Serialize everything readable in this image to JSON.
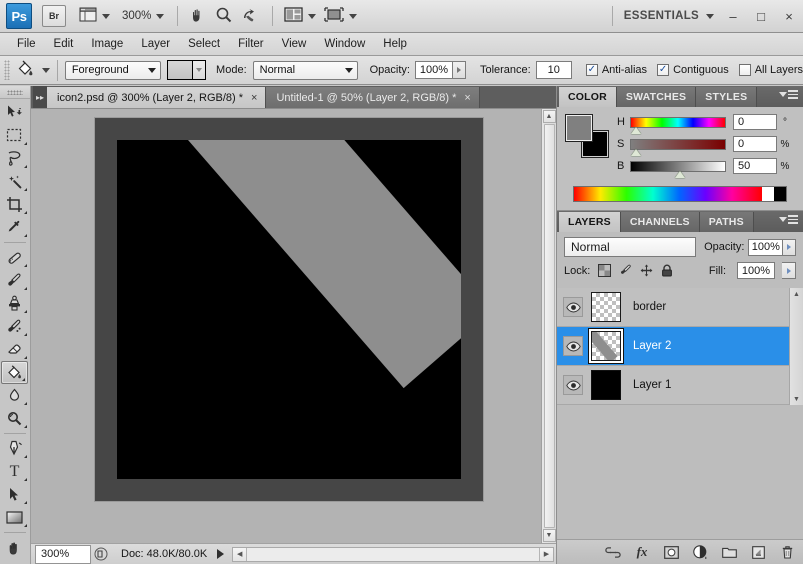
{
  "app": {
    "logo_text": "Ps",
    "bridge_label": "Br",
    "zoom_level": "300%",
    "workspace": "ESSENTIALS",
    "window_controls": {
      "minimize": "–",
      "maximize": "□",
      "close": "×"
    },
    "appbar_icons": [
      {
        "name": "mini-bridge-icon",
        "glyph": "▤"
      },
      {
        "name": "hand-tool-icon",
        "glyph": "✋"
      },
      {
        "name": "zoom-tool-icon",
        "glyph": "⚲"
      },
      {
        "name": "rotate-view-tool-icon",
        "glyph": "⟳"
      },
      {
        "name": "arrange-documents-icon",
        "glyph": "▦"
      },
      {
        "name": "screen-mode-icon",
        "glyph": "▣"
      }
    ]
  },
  "menubar": {
    "items": [
      {
        "label": "File"
      },
      {
        "label": "Edit"
      },
      {
        "label": "Image"
      },
      {
        "label": "Layer"
      },
      {
        "label": "Select"
      },
      {
        "label": "Filter"
      },
      {
        "label": "View"
      },
      {
        "label": "Window"
      },
      {
        "label": "Help"
      }
    ]
  },
  "options_bar": {
    "tool_icon": "paint-bucket-icon",
    "fill_source": "Foreground",
    "pattern_swatch_color": "#cccccc",
    "mode_label": "Mode:",
    "mode_value": "Normal",
    "opacity_label": "Opacity:",
    "opacity_value": "100%",
    "tolerance_label": "Tolerance:",
    "tolerance_value": "10",
    "checkboxes": [
      {
        "label": "Anti-alias",
        "checked": true
      },
      {
        "label": "Contiguous",
        "checked": true
      },
      {
        "label": "All Layers",
        "checked": false
      }
    ],
    "check_glyph": "✓"
  },
  "tools": {
    "items": [
      {
        "name": "move-tool",
        "glyph": "✣"
      },
      {
        "name": "rectangular-marquee-tool",
        "glyph": "⬚"
      },
      {
        "name": "lasso-tool",
        "glyph": "⌇"
      },
      {
        "name": "magic-wand-tool",
        "glyph": "✨"
      },
      {
        "name": "crop-tool",
        "glyph": "⌗"
      },
      {
        "name": "eyedropper-tool",
        "glyph": "✒"
      },
      {
        "name": "spot-healing-brush-tool",
        "glyph": "✇"
      },
      {
        "name": "brush-tool",
        "glyph": "✎"
      },
      {
        "name": "clone-stamp-tool",
        "glyph": "⚓"
      },
      {
        "name": "history-brush-tool",
        "glyph": "✐"
      },
      {
        "name": "eraser-tool",
        "glyph": "▱"
      },
      {
        "name": "paint-bucket-tool",
        "glyph": "◢",
        "selected": true
      },
      {
        "name": "blur-tool",
        "glyph": "◖"
      },
      {
        "name": "dodge-tool",
        "glyph": "◍"
      },
      {
        "name": "pen-tool",
        "glyph": "✑"
      },
      {
        "name": "horizontal-type-tool",
        "glyph": "T"
      },
      {
        "name": "path-selection-tool",
        "glyph": "➤"
      },
      {
        "name": "rectangle-tool",
        "glyph": "■"
      },
      {
        "name": "hand-tool",
        "glyph": "✋"
      }
    ]
  },
  "documents": {
    "tabs": [
      {
        "title": "icon2.psd @ 300% (Layer 2, RGB/8) *",
        "active": true,
        "close": "×"
      },
      {
        "title": "Untitled-1 @ 50% (Layer 2, RGB/8) *",
        "active": false,
        "close": "×"
      }
    ]
  },
  "canvas": {
    "background_color": "#b3b3b3",
    "artboard_border_color": "#464646",
    "artboard_fill_color": "#000000",
    "shape_color": "#8e8e8e"
  },
  "statusbar": {
    "zoom_value": "300%",
    "doc_info": "Doc: 48.0K/80.0K",
    "play_glyph": "▶"
  },
  "color_panel": {
    "tabs": [
      {
        "label": "COLOR",
        "active": true
      },
      {
        "label": "SWATCHES",
        "active": false
      },
      {
        "label": "STYLES",
        "active": false
      }
    ],
    "foreground_color": "#808080",
    "background_color": "#000000",
    "sliders": [
      {
        "label": "H",
        "value": "0",
        "unit": "°",
        "thumb_pct": 6
      },
      {
        "label": "S",
        "value": "0",
        "unit": "%",
        "thumb_pct": 6
      },
      {
        "label": "B",
        "value": "50",
        "unit": "%",
        "thumb_pct": 50
      }
    ]
  },
  "layers_panel": {
    "tabs": [
      {
        "label": "LAYERS",
        "active": true
      },
      {
        "label": "CHANNELS",
        "active": false
      },
      {
        "label": "PATHS",
        "active": false
      }
    ],
    "blend_mode": "Normal",
    "opacity_label": "Opacity:",
    "opacity_value": "100%",
    "lock_label": "Lock:",
    "fill_label": "Fill:",
    "fill_value": "100%",
    "lock_icons": [
      {
        "name": "lock-transparent-pixels-icon",
        "glyph": "▨"
      },
      {
        "name": "lock-image-pixels-icon",
        "glyph": "✐"
      },
      {
        "name": "lock-position-icon",
        "glyph": "✥"
      },
      {
        "name": "lock-all-icon",
        "glyph": "ὑ2"
      }
    ],
    "layers": [
      {
        "name": "border",
        "selected": false,
        "thumb": "transparent",
        "visible": true
      },
      {
        "name": "Layer 2",
        "selected": true,
        "thumb": "diagonal-bar",
        "visible": true
      },
      {
        "name": "Layer 1",
        "selected": false,
        "thumb": "black",
        "visible": true
      }
    ],
    "eye_glyph": "◉",
    "footer_icons": [
      {
        "name": "link-layers-icon",
        "glyph": "⚭"
      },
      {
        "name": "layer-style-icon",
        "glyph": "ƒx"
      },
      {
        "name": "layer-mask-icon",
        "glyph": "▣"
      },
      {
        "name": "adjustment-layer-icon",
        "glyph": "◑"
      },
      {
        "name": "new-group-icon",
        "glyph": "▭"
      },
      {
        "name": "new-layer-icon",
        "glyph": "❐"
      },
      {
        "name": "delete-layer-icon",
        "glyph": "⌦"
      }
    ]
  }
}
